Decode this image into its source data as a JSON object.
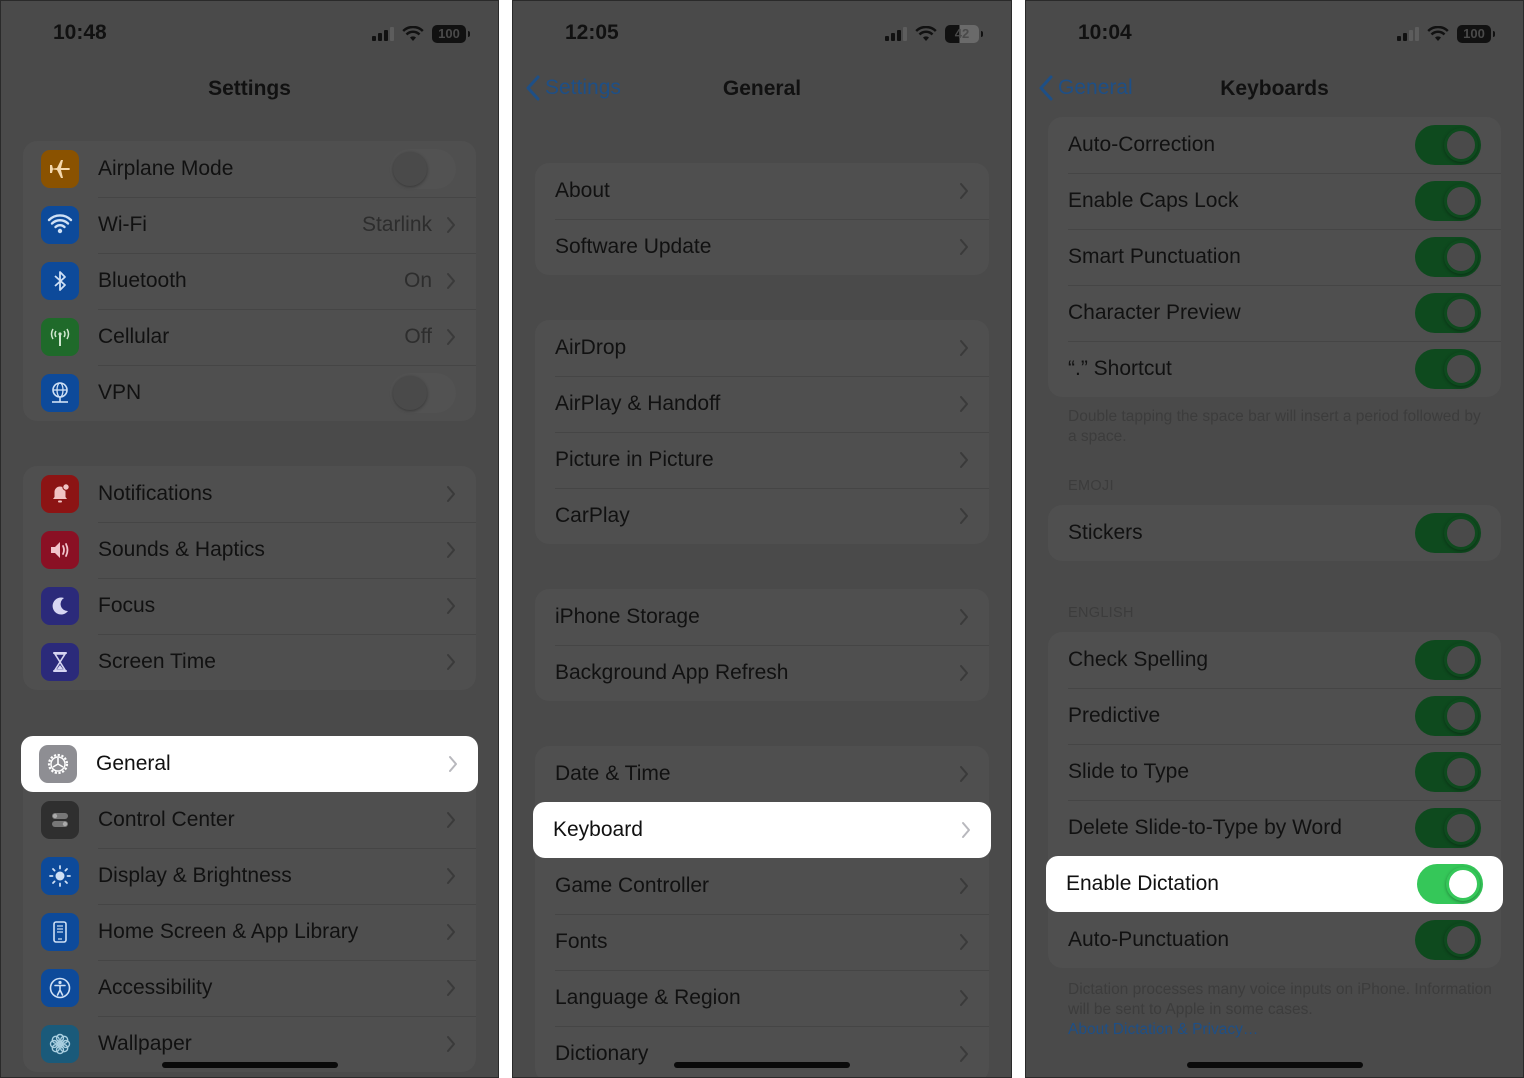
{
  "colors": {
    "overlay_bg": "#4a4a4a",
    "group_bg": "#4f4f4f",
    "highlight_bg": "#ffffff",
    "link_blue": "#1e4f86",
    "toggle_on_dim": "#0e4a1e",
    "toggle_on_active": "#35c759"
  },
  "screens": [
    {
      "status": {
        "time": "10:48",
        "battery": "100"
      },
      "nav": {
        "title": "Settings"
      },
      "groups": [
        {
          "rows": [
            {
              "label": "Airplane Mode",
              "icon": "airplane-icon",
              "icon_color": "#8a5200",
              "control": "toggle",
              "toggle_on": false
            },
            {
              "label": "Wi-Fi",
              "icon": "wifi-icon",
              "icon_color": "#0d4a9a",
              "value": "Starlink",
              "control": "chevron"
            },
            {
              "label": "Bluetooth",
              "icon": "bluetooth-icon",
              "icon_color": "#0d4a9a",
              "value": "On",
              "control": "chevron"
            },
            {
              "label": "Cellular",
              "icon": "cellular-icon",
              "icon_color": "#1f6a2a",
              "value": "Off",
              "control": "chevron"
            },
            {
              "label": "VPN",
              "icon": "vpn-globe-icon",
              "icon_color": "#0d4a9a",
              "control": "toggle",
              "toggle_on": false
            }
          ]
        },
        {
          "rows": [
            {
              "label": "Notifications",
              "icon": "notifications-bell-icon",
              "icon_color": "#8c1414",
              "control": "chevron"
            },
            {
              "label": "Sounds & Haptics",
              "icon": "speaker-icon",
              "icon_color": "#8a1024",
              "control": "chevron"
            },
            {
              "label": "Focus",
              "icon": "moon-icon",
              "icon_color": "#2b2a7a",
              "control": "chevron"
            },
            {
              "label": "Screen Time",
              "icon": "hourglass-icon",
              "icon_color": "#2b2a7a",
              "control": "chevron"
            }
          ]
        },
        {
          "rows": [
            {
              "label": "General",
              "icon": "gear-icon",
              "icon_color": "#8e8e93",
              "control": "chevron",
              "highlighted": true
            },
            {
              "label": "Control Center",
              "icon": "control-center-icon",
              "icon_color": "#2f2f2f",
              "control": "chevron"
            },
            {
              "label": "Display & Brightness",
              "icon": "brightness-sun-icon",
              "icon_color": "#0d4a9a",
              "control": "chevron"
            },
            {
              "label": "Home Screen & App Library",
              "icon": "home-screen-icon",
              "icon_color": "#0d4a9a",
              "control": "chevron"
            },
            {
              "label": "Accessibility",
              "icon": "accessibility-icon",
              "icon_color": "#0d4a9a",
              "control": "chevron"
            },
            {
              "label": "Wallpaper",
              "icon": "wallpaper-flower-icon",
              "icon_color": "#1a5a7a",
              "control": "chevron"
            }
          ]
        }
      ]
    },
    {
      "status": {
        "time": "12:05",
        "battery": "42"
      },
      "nav": {
        "title": "General",
        "back": "Settings"
      },
      "groups": [
        {
          "rows": [
            {
              "label": "About"
            },
            {
              "label": "Software Update"
            }
          ]
        },
        {
          "rows": [
            {
              "label": "AirDrop"
            },
            {
              "label": "AirPlay & Handoff"
            },
            {
              "label": "Picture in Picture"
            },
            {
              "label": "CarPlay"
            }
          ]
        },
        {
          "rows": [
            {
              "label": "iPhone Storage"
            },
            {
              "label": "Background App Refresh"
            }
          ]
        },
        {
          "rows": [
            {
              "label": "Date & Time"
            },
            {
              "label": "Keyboard",
              "highlighted": true
            },
            {
              "label": "Game Controller"
            },
            {
              "label": "Fonts"
            },
            {
              "label": "Language & Region"
            },
            {
              "label": "Dictionary"
            }
          ]
        }
      ]
    },
    {
      "status": {
        "time": "10:04",
        "battery": "100"
      },
      "nav": {
        "title": "Keyboards",
        "back": "General"
      },
      "groups": [
        {
          "rows": [
            {
              "label": "Auto-Correction",
              "toggle_on": true
            },
            {
              "label": "Enable Caps Lock",
              "toggle_on": true
            },
            {
              "label": "Smart Punctuation",
              "toggle_on": true
            },
            {
              "label": "Character Preview",
              "toggle_on": true
            },
            {
              "label": "“.” Shortcut",
              "toggle_on": true
            }
          ],
          "footer": "Double tapping the space bar will insert a period followed by a space."
        },
        {
          "header": "EMOJI",
          "rows": [
            {
              "label": "Stickers",
              "toggle_on": true
            }
          ]
        },
        {
          "header": "ENGLISH",
          "rows": [
            {
              "label": "Check Spelling",
              "toggle_on": true
            },
            {
              "label": "Predictive",
              "toggle_on": true
            },
            {
              "label": "Slide to Type",
              "toggle_on": true
            },
            {
              "label": "Delete Slide-to-Type by Word",
              "toggle_on": true
            },
            {
              "label": "Enable Dictation",
              "toggle_on": true,
              "highlighted": true
            },
            {
              "label": "Auto-Punctuation",
              "toggle_on": true
            }
          ],
          "footer": "Dictation processes many voice inputs on iPhone. Information will be sent to Apple in some cases.",
          "footer_link": "About Dictation & Privacy…"
        }
      ]
    }
  ]
}
